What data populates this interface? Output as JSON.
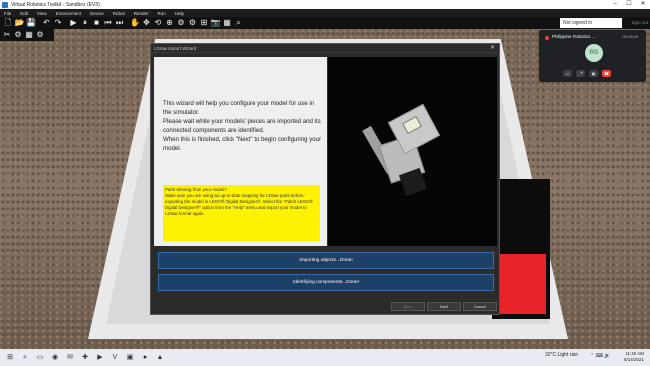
{
  "window": {
    "title": "Virtual Robotics Toolkit - Sandbox (EV3)",
    "controls": [
      "–",
      "☐",
      "✕"
    ]
  },
  "menu": [
    "File",
    "Edit",
    "View",
    "Environment",
    "Device",
    "Robot",
    "Render",
    "Run",
    "Help"
  ],
  "toolbar": {
    "icons": [
      "new-icon",
      "open-icon",
      "save-icon",
      "undo-icon",
      "redo-icon",
      "play-icon",
      "pause-icon",
      "stop-icon",
      "reset-icon",
      "step-icon",
      "hand-icon",
      "move-icon",
      "rotate-icon",
      "orbit-icon",
      "settings-icon",
      "robot-icon",
      "sensor-icon",
      "camera-icon",
      "grid-icon",
      "zoom-icon"
    ],
    "glyphs": [
      "🗋",
      "📂",
      "💾",
      "↶",
      "↷",
      "▶",
      "⏸",
      "■",
      "⏮",
      "⏭",
      "✋",
      "✥",
      "⟲",
      "⊕",
      "⚙",
      "⚙",
      "⊞",
      "📷",
      "▦",
      "⌕"
    ],
    "sign_in": "Not signed in",
    "sign_out": "Sign out"
  },
  "toolbar2": {
    "glyphs": [
      "✂",
      "⚙",
      "▦",
      "⚙"
    ]
  },
  "meet": {
    "org": "Philippine Robotics ...",
    "timer": "00:13:09",
    "avatar": "RS",
    "controls": [
      "▭",
      "🎤",
      "▣",
      "☎"
    ]
  },
  "dialog": {
    "title": "LDraw Import Wizard",
    "close": "✕",
    "intro": "This wizard will help you configure your model for use in the simulator.\nPlease wait while your models' pieces are imported and its connected components are identified.\nWhen this is finished, click \"Next\" to begin configuring your model.",
    "warning": "Parts Missing from your model?\nMake sure you are using an up-to-date mapping for LDraw parts before exporting the model in LEGO® Digital Designer®. Select the \"Patch LEGO® Digital Designer®\" option from the \"Help\" menu and export your model to LDraw format again.",
    "status": [
      "Importing objects...Done!",
      "Identifying components...Done!"
    ],
    "buttons": {
      "back": "Back",
      "next": "Next",
      "cancel": "Cancel"
    }
  },
  "taskbar": {
    "icons": [
      "⊞",
      "⌕",
      "▭",
      "◉",
      "✉",
      "✚",
      "▶",
      "V",
      "▣",
      "●",
      "▲"
    ],
    "weather": "32°C  Light rain",
    "tray": "⌃ ⌨ 🔊",
    "time": "11:40 AM",
    "date": "6/14/2021"
  },
  "colors": {
    "accent_status": "#1e3f66",
    "warning_bg": "#fff200",
    "mat_red": "#e8232a"
  }
}
